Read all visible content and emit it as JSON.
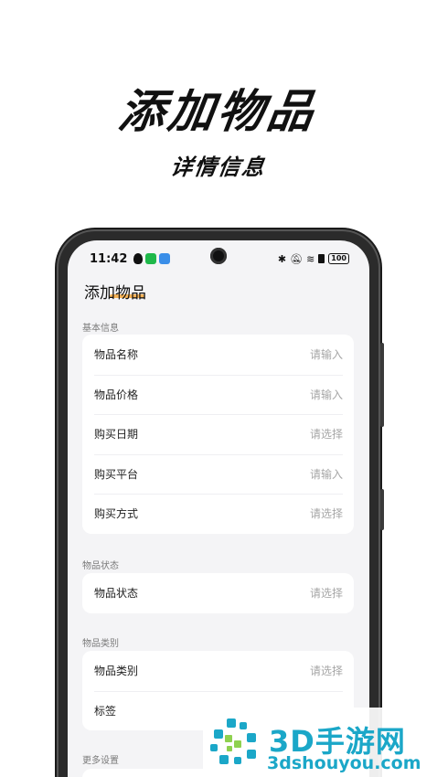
{
  "hero": {
    "title": "添加物品",
    "subtitle": "详情信息"
  },
  "status_bar": {
    "time": "11:42",
    "battery": "100"
  },
  "header": {
    "title": "添加物品"
  },
  "sections": {
    "basic": {
      "label": "基本信息",
      "rows": [
        {
          "label": "物品名称",
          "value": "请输入"
        },
        {
          "label": "物品价格",
          "value": "请输入"
        },
        {
          "label": "购买日期",
          "value": "请选择"
        },
        {
          "label": "购买平台",
          "value": "请输入"
        },
        {
          "label": "购买方式",
          "value": "请选择"
        }
      ]
    },
    "status": {
      "label": "物品状态",
      "rows": [
        {
          "label": "物品状态",
          "value": "请选择"
        }
      ]
    },
    "category": {
      "label": "物品类别",
      "rows": [
        {
          "label": "物品类别",
          "value": "请选择"
        },
        {
          "label": "标签",
          "value": ""
        }
      ]
    },
    "more": {
      "label": "更多设置"
    }
  },
  "watermark": {
    "text": "3D手游网",
    "url": "3dshouyou.com"
  },
  "colors": {
    "accent": "#f3a63b",
    "watermark": "#1ba7c8",
    "background": "#f4f4f6",
    "placeholder": "#a6a6a6"
  }
}
